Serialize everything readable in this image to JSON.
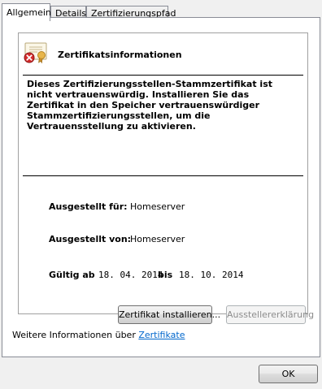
{
  "tabs": [
    {
      "label": "Allgemein",
      "active": true
    },
    {
      "label": "Details",
      "active": false
    },
    {
      "label": "Zertifizierungspfad",
      "active": false
    }
  ],
  "certificate": {
    "icon": "certificate-error-icon",
    "heading": "Zertifikatsinformationen",
    "warning": "Dieses Zertifizierungsstellen-Stammzertifikat ist nicht vertrauenswürdig. Installieren Sie das Zertifikat in den Speicher vertrauenswürdiger Stammzertifizierungsstellen, um die Vertrauensstellung zu aktivieren.",
    "issued_to_label": "Ausgestellt für:",
    "issued_to_value": "Homeserver",
    "issued_by_label": "Ausgestellt von:",
    "issued_by_value": "Homeserver",
    "valid_label": "Gültig ab",
    "valid_from": "18. 04. 2014",
    "valid_to_label": "bis",
    "valid_to": "18. 10. 2014"
  },
  "buttons": {
    "install": "Zertifikat installieren...",
    "issuer_statement": "Ausstellererklärung",
    "ok": "OK"
  },
  "more_info": {
    "text": "Weitere Informationen über",
    "link": "Zertifikate"
  },
  "colors": {
    "link": "#0066cc",
    "error_badge": "#d42c2c",
    "seal": "#e8b64a"
  }
}
